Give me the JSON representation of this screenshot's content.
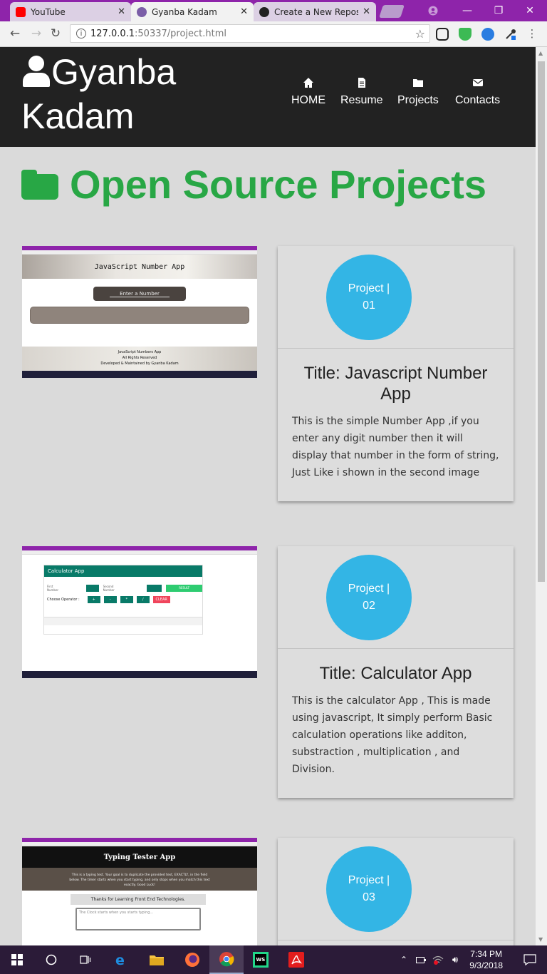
{
  "browser": {
    "tabs": [
      {
        "title": "YouTube",
        "favicon": "youtube-icon",
        "color": "#ff0000"
      },
      {
        "title": "Gyanba Kadam",
        "favicon": "chrome-page-icon",
        "color": "#7b5ea7"
      },
      {
        "title": "Create a New Reposit",
        "favicon": "github-icon",
        "color": "#222222"
      }
    ],
    "url_host": "127.0.0.1",
    "url_rest": ":50337/project.html"
  },
  "site": {
    "brand": "Gyanba Kadam",
    "nav": [
      {
        "label": "HOME",
        "icon": "home-icon"
      },
      {
        "label": "Resume",
        "icon": "file-icon"
      },
      {
        "label": "Projects",
        "icon": "folder-icon"
      },
      {
        "label": "Contacts",
        "icon": "envelope-icon"
      }
    ],
    "section_title": "Open Source Projects",
    "accent": "#28a745",
    "badge_color": "#33b5e5"
  },
  "projects": [
    {
      "badge": "Project | 01",
      "title": "Title: Javascript Number App",
      "description": "This is the simple Number App ,if you enter any digit number then it will display that number in the form of string, Just Like i shown in the second image",
      "shot": {
        "header": "JavaScript Number App",
        "input_placeholder": "Enter a Number",
        "footer_title": "JavaScript Numbers App",
        "footer_rights": "All Rights Reserved",
        "footer_dev": "Developed & Maintained by Gyanba Kadam"
      }
    },
    {
      "badge": "Project | 02",
      "title": "Title: Calculator App",
      "description": "This is the calculator App , This is made using javascript, It simply perform Basic calculation operations like additon, substraction , multiplication , and Division.",
      "shot": {
        "header": "Calculator App",
        "first_number": "First Number",
        "second_number": "Second Number",
        "result": "RESULT",
        "choose": "Choose Operator :",
        "clear": "CLEAR",
        "ops": [
          "+",
          "-",
          "*",
          "/"
        ]
      }
    },
    {
      "badge": "Project | 03",
      "title": "",
      "description": "",
      "shot": {
        "header": "Typing Tester App",
        "intro": "This is a typing test. Your goal is to duplicate the provided text, EXACTLY, in the field below. The timer starts when you start typing, and only stops when you match this text exactly. Good Luck!",
        "sample": "Thanks for Learning Front End Technologies.",
        "placeholder": "The Clock starts when you starts typing..."
      }
    }
  ],
  "taskbar": {
    "time": "7:34 PM",
    "date": "9/3/2018"
  }
}
